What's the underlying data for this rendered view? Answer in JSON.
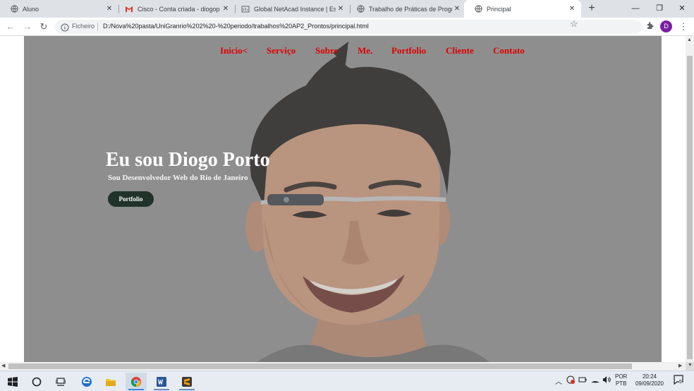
{
  "browser": {
    "tabs": [
      {
        "title": "Aluno",
        "icon": "globe-icon",
        "active": false
      },
      {
        "title": "Cisco - Conta criada - diogop",
        "icon": "gmail-icon",
        "active": false
      },
      {
        "title": "Global NetAcad Instance | Esto",
        "icon": "netacad-icon",
        "active": false
      },
      {
        "title": "Trabalho de Práticas de Progra",
        "icon": "globe-icon",
        "active": false
      },
      {
        "title": "Principal",
        "icon": "globe-icon",
        "active": true
      }
    ],
    "new_tab": "+",
    "address": {
      "scheme_label": "Ficheiro",
      "url": "D:/Nova%20pasta/UniGranrio%202%20-%20periodo/trabalhos%20AP2_Prontos/principal.html"
    },
    "profile_initial": "D",
    "profile_color": "#7b1fa2"
  },
  "page": {
    "nav": [
      "Inicio<",
      "Serviço",
      "Sobre",
      "Me.",
      "Portfolio",
      "Cliente",
      "Contato"
    ],
    "nav_color": "#e00000",
    "hero_title": "Eu sou Diogo Porto",
    "hero_subtitle": "Sou Desenvolvedor Web do Rio de Janeiro",
    "hero_button": "Portfolio"
  },
  "taskbar": {
    "language_line1": "POR",
    "language_line2": "PTB",
    "time": "20:24",
    "date": "09/09/2020",
    "notification_count": "5"
  }
}
